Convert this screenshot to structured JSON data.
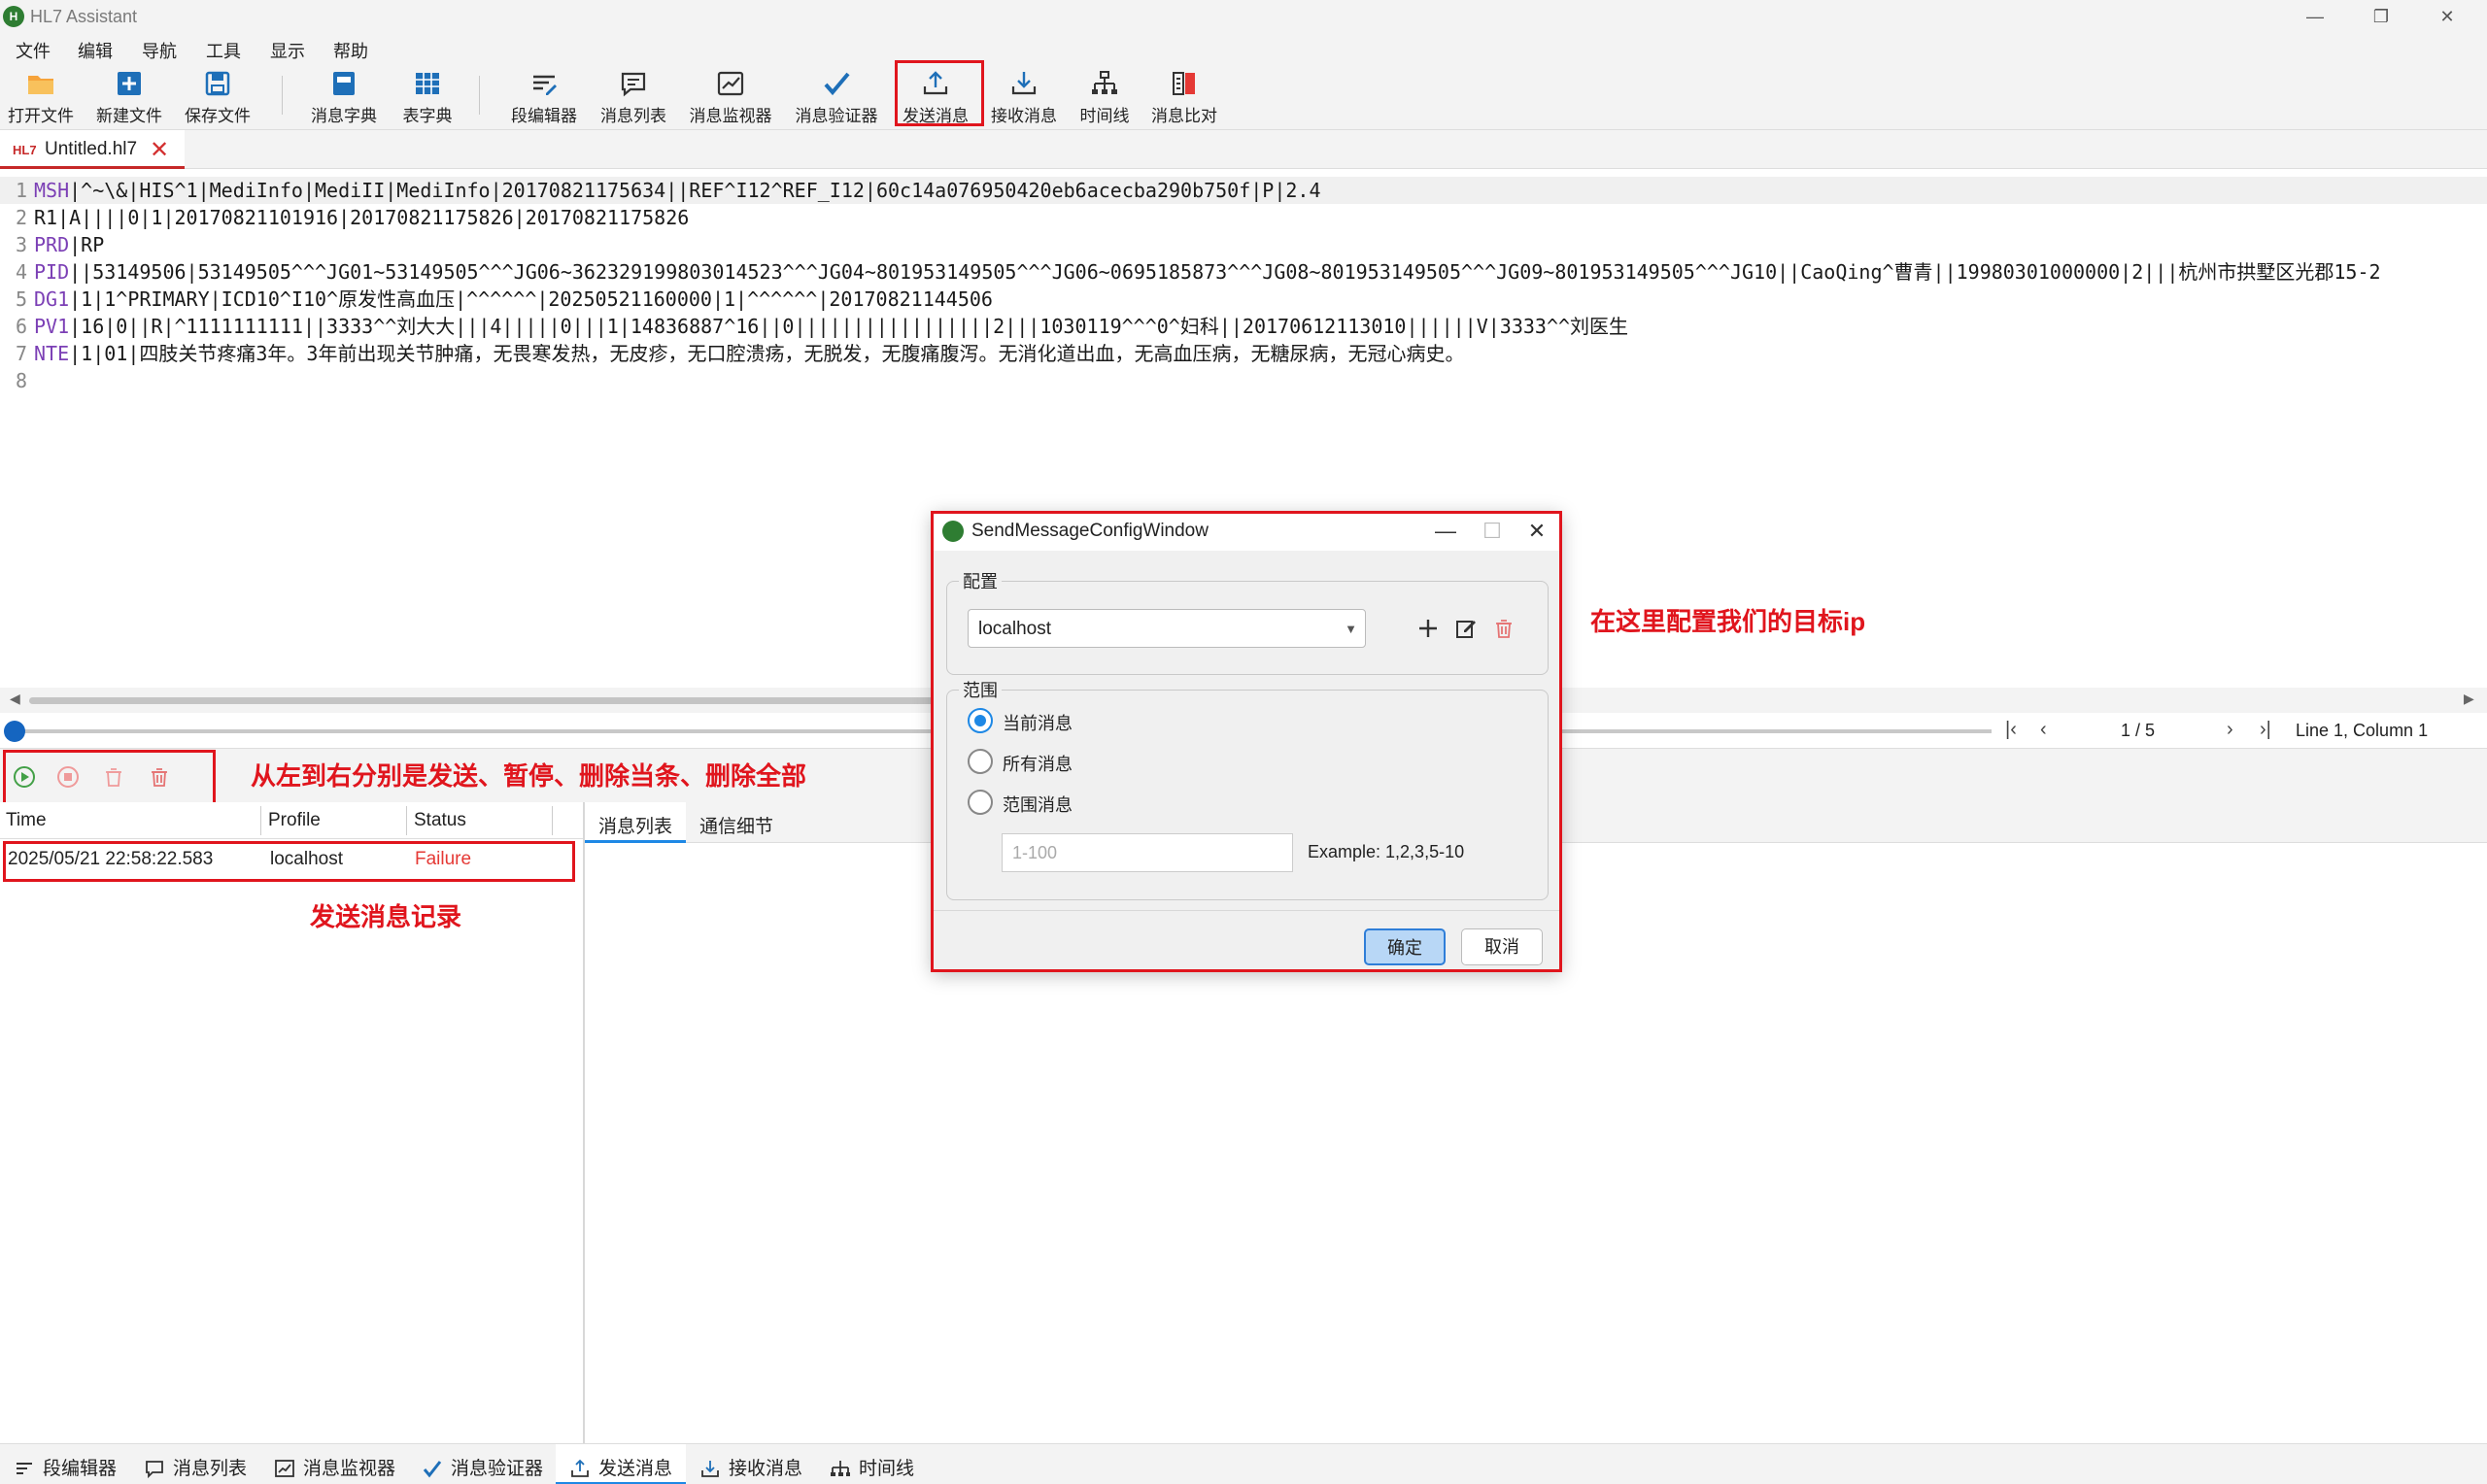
{
  "window": {
    "title": "HL7 Assistant"
  },
  "menu": [
    "文件",
    "编辑",
    "导航",
    "工具",
    "显示",
    "帮助"
  ],
  "toolbar": {
    "open_file": "打开文件",
    "new_file": "新建文件",
    "save_file": "保存文件",
    "msg_dict": "消息字典",
    "table_dict": "表字典",
    "segment_editor": "段编辑器",
    "msg_list": "消息列表",
    "msg_monitor": "消息监视器",
    "msg_validator": "消息验证器",
    "send_msg": "发送消息",
    "recv_msg": "接收消息",
    "timeline": "时间线",
    "msg_compare": "消息比对"
  },
  "doc_tab": {
    "badge": "HL7",
    "name": "Untitled.hl7"
  },
  "editor": {
    "lines": [
      {
        "num": "1",
        "seg": "MSH",
        "rest": "|^~\\&|HIS^1|MediInfo|MediII|MediInfo|20170821175634||REF^I12^REF_I12|60c14a076950420eb6acecba290b750f|P|2.4"
      },
      {
        "num": "2",
        "seg": "",
        "rest": "R1|A||||0|1|20170821101916|20170821175826|20170821175826"
      },
      {
        "num": "3",
        "seg": "PRD",
        "rest": "|RP"
      },
      {
        "num": "4",
        "seg": "PID",
        "rest": "||53149506|53149505^^^JG01~53149505^^^JG06~362329199803014523^^^JG04~801953149505^^^JG06~0695185873^^^JG08~801953149505^^^JG09~801953149505^^^JG10||CaoQing^曹青||19980301000000|2|||杭州市拱墅区光郡15-2"
      },
      {
        "num": "5",
        "seg": "DG1",
        "rest": "|1|1^PRIMARY|ICD10^I10^原发性高血压|^^^^^^|20250521160000|1|^^^^^^|20170821144506"
      },
      {
        "num": "6",
        "seg": "PV1",
        "rest": "|16|0||R|^1111111111||3333^^刘大大|||4|||||0|||1|14836887^16||0|||||||||||||||||2|||1030119^^^0^妇科||20170612113010||||||V|3333^^刘医生"
      },
      {
        "num": "7",
        "seg": "NTE",
        "rest": "|1|01|四肢关节疼痛3年。3年前出现关节肿痛，无畏寒发热，无皮疹，无口腔溃疡，无脱发，无腹痛腹泻。无消化道出血，无高血压病，无糖尿病，无冠心病史。"
      },
      {
        "num": "8",
        "seg": "",
        "rest": ""
      }
    ]
  },
  "nav": {
    "page": "1 / 5",
    "position": "Line 1, Column 1"
  },
  "send_panel": {
    "annotation_buttons": "从左到右分别是发送、暂停、删除当条、删除全部",
    "columns": {
      "time": "Time",
      "profile": "Profile",
      "status": "Status"
    },
    "rows": [
      {
        "time": "2025/05/21 22:58:22.583",
        "profile": "localhost",
        "status": "Failure"
      }
    ],
    "annotation_records": "发送消息记录",
    "tabs": [
      "消息列表",
      "通信细节"
    ]
  },
  "bottom_tabs": [
    "段编辑器",
    "消息列表",
    "消息监视器",
    "消息验证器",
    "发送消息",
    "接收消息",
    "时间线"
  ],
  "dialog": {
    "title": "SendMessageConfigWindow",
    "config_label": "配置",
    "config_value": "localhost",
    "range_label": "范围",
    "options": [
      "当前消息",
      "所有消息",
      "范围消息"
    ],
    "selected_option": "当前消息",
    "range_placeholder": "1-100",
    "example": "Example: 1,2,3,5-10",
    "ok": "确定",
    "cancel": "取消",
    "annotation": "在这里配置我们的目标ip"
  },
  "colors": {
    "annotation_red": "#e0151d",
    "accent_blue": "#1e88e5",
    "failure_red": "#e53935",
    "segment_purple": "#7b3fb5"
  },
  "icons": {
    "open_file": "folder-icon",
    "new_file": "plus-icon",
    "save_file": "save-icon",
    "send": "play-icon",
    "pause": "stop-icon",
    "delete_one": "trash-icon",
    "delete_all": "trash-icon"
  }
}
